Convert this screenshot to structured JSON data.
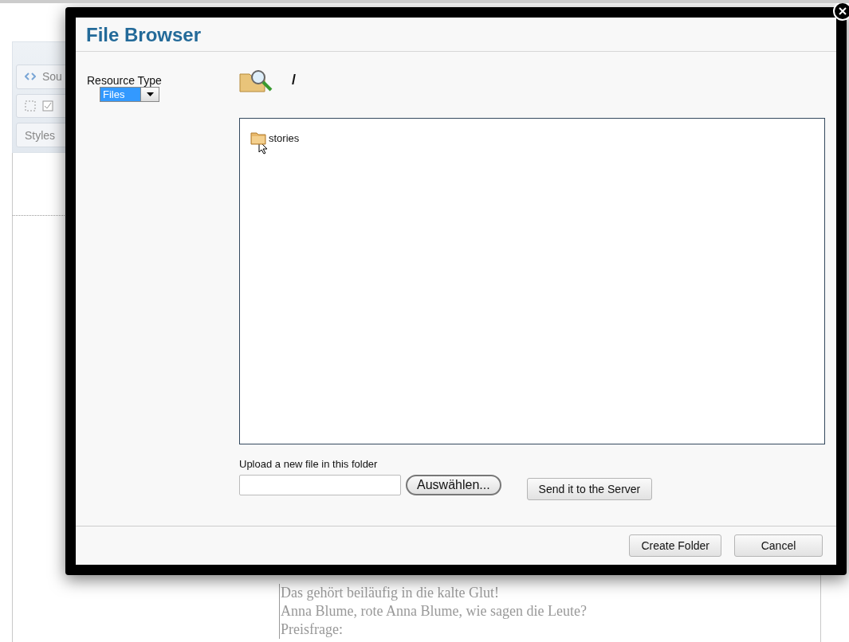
{
  "editor": {
    "toolbar": [
      {
        "kind": "button",
        "label": "Sou"
      },
      {
        "kind": "icons"
      },
      {
        "kind": "combo",
        "label": "Styles"
      }
    ],
    "text_lines": [
      "Das gehört beiläufig in die kalte Glut!",
      "Anna Blume, rote Anna Blume, wie sagen die Leute?",
      "Preisfrage:"
    ]
  },
  "dialog": {
    "title": "File Browser",
    "resource_type": {
      "label": "Resource Type",
      "value": "Files"
    },
    "path": "/",
    "files": [
      {
        "name": "stories",
        "kind": "folder"
      }
    ],
    "upload": {
      "label": "Upload a new file in this folder",
      "browse_button": "Auswählen...",
      "send_button": "Send it to the Server"
    },
    "buttons": [
      "Create Folder",
      "Cancel"
    ]
  }
}
